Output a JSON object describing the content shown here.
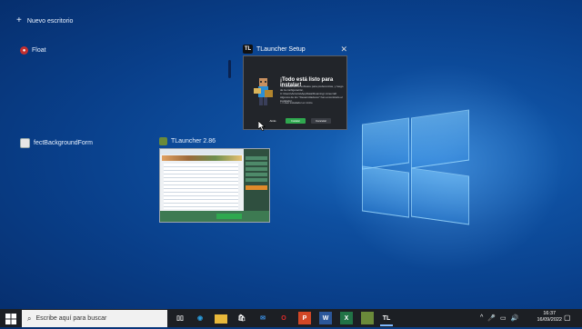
{
  "desktop": {
    "new_desktop_label": "Nuevo escritorio"
  },
  "windows": {
    "float": {
      "title": "Float"
    },
    "fbackground": {
      "title": "fectBackgroundForm"
    },
    "tlauncher_setup": {
      "title": "TLauncher Setup",
      "badge": "TL",
      "heading": "¡Todo está listo para instalar!",
      "description": "Ya instalamos el software para preferencias, y luego de la configuración, C:\\Users\\Antonia\\AppData\\Roaming\\.minecraft Algunos de los \"Desarrolladores\" han encontrado el instalador.",
      "checkbox_label": "Usar instalador en inicio",
      "buttons": [
        "Atrás",
        "Instalar",
        "Cancelar"
      ]
    },
    "tlauncher": {
      "title": "TLauncher 2.86"
    }
  },
  "taskbar": {
    "search_placeholder": "Escribe aquí para buscar",
    "pinned_icons": [
      "task-view-icon",
      "edge-icon",
      "file-explorer-icon",
      "store-icon",
      "mail-icon",
      "opera-icon",
      "powerpoint-icon",
      "word-icon",
      "excel-icon",
      "minecraft-icon",
      "tlauncher-icon"
    ],
    "tl_label": "TL",
    "clock_time": "16:37",
    "clock_date": "16/09/2022"
  },
  "colors": {
    "accent_green": "#2fa84f",
    "taskbar_bg": "#1c1f24"
  }
}
